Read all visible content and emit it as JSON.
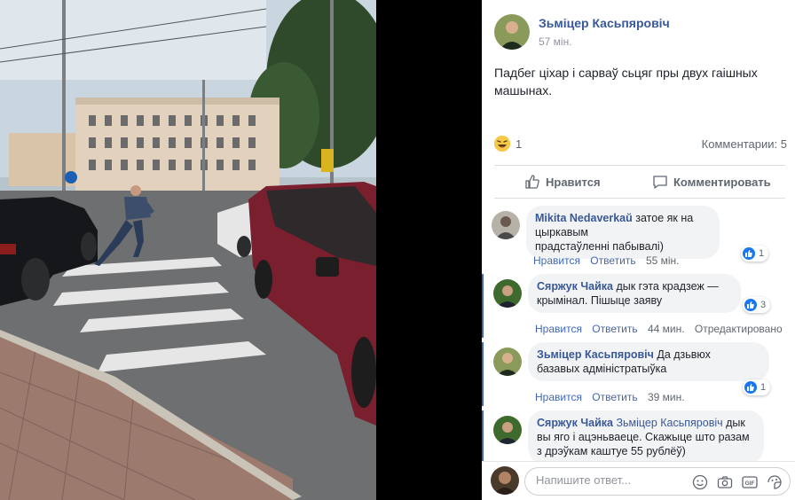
{
  "post": {
    "author": "Зьміцер Касьпяровіч",
    "time": "57 мін.",
    "text": "Падбег ціхар і сарваў сьцяг пры двух гаішных машынах.",
    "reaction_count": "1",
    "comments_count": "Комментарии: 5",
    "like_label": "Нравится",
    "comment_label": "Комментировать"
  },
  "comments": [
    {
      "name": "Mikita Nedaverkaŭ",
      "mention": "",
      "text_line1": " затое як на цыркавым",
      "text_line2": "прадстаўленні пабывалі)",
      "text_line3": "",
      "like": "Нравится",
      "reply": "Ответить",
      "time": "55 мін.",
      "edited": "",
      "likes": "1"
    },
    {
      "name": "Сяржук Чайка",
      "mention": "",
      "text_line1": " дык гэта крадзеж —",
      "text_line2": "крымінал. Пішыце заяву",
      "text_line3": "",
      "like": "Нравится",
      "reply": "Ответить",
      "time": "44 мин.",
      "edited": "Отредактировано",
      "likes": "3"
    },
    {
      "name": "Зьміцер Касьпяровіч",
      "mention": "",
      "text_line1": " Да дзьвюх",
      "text_line2": "базавых адміністратыўка",
      "text_line3": "",
      "like": "Нравится",
      "reply": "Ответить",
      "time": "39 мин.",
      "edited": "",
      "likes": "1"
    },
    {
      "name": "Сяржук Чайка",
      "mention": " Зьміцер Касьпяровіч",
      "text_line1": " дык",
      "text_line2": "вы яго і ацэньваеце. Скажыце што разам",
      "text_line3": "з дрэўкам каштуе 55 рублёў)",
      "like": "",
      "reply": "",
      "time": "",
      "edited": "",
      "likes": ""
    }
  ],
  "composer": {
    "placeholder": "Напишите ответ..."
  },
  "colors": {
    "link": "#385898",
    "action": "#4267b2",
    "like_blue": "#1877f2",
    "bubble": "#f2f3f5"
  },
  "icons": [
    "haha-reaction-icon",
    "thumbs-up-icon",
    "comment-icon",
    "emoji-icon",
    "camera-icon",
    "gif-icon",
    "sticker-icon"
  ]
}
